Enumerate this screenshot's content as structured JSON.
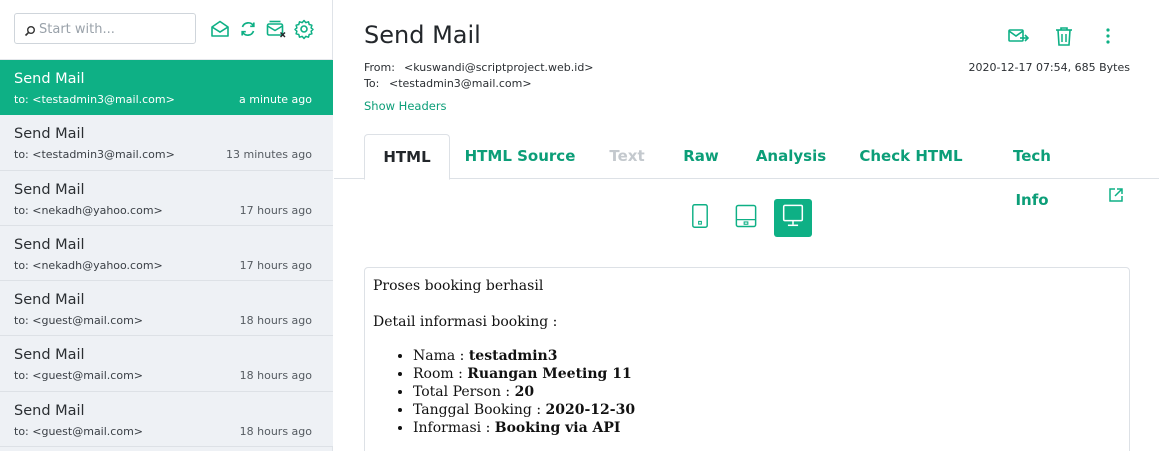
{
  "search": {
    "placeholder": "Start with..."
  },
  "toolbar_icons": [
    "mail-open-icon",
    "refresh-icon",
    "inbox-clear-icon",
    "settings-icon"
  ],
  "mails": [
    {
      "subject": "Send Mail",
      "to": "to: <testadmin3@mail.com>",
      "time": "a minute ago",
      "active": true
    },
    {
      "subject": "Send Mail",
      "to": "to: <testadmin3@mail.com>",
      "time": "13 minutes ago"
    },
    {
      "subject": "Send Mail",
      "to": "to: <nekadh@yahoo.com>",
      "time": "17 hours ago"
    },
    {
      "subject": "Send Mail",
      "to": "to: <nekadh@yahoo.com>",
      "time": "17 hours ago"
    },
    {
      "subject": "Send Mail",
      "to": "to: <guest@mail.com>",
      "time": "18 hours ago"
    },
    {
      "subject": "Send Mail",
      "to": "to: <guest@mail.com>",
      "time": "18 hours ago"
    },
    {
      "subject": "Send Mail",
      "to": "to: <guest@mail.com>",
      "time": "18 hours ago"
    }
  ],
  "message": {
    "title": "Send Mail",
    "from_label": "From:",
    "from": "<kuswandi@scriptproject.web.id>",
    "to_label": "To:",
    "to": "<testadmin3@mail.com>",
    "date_size": "2020-12-17 07:54, 685 Bytes",
    "show_headers": "Show Headers"
  },
  "tabs": [
    {
      "label": "HTML",
      "state": "active"
    },
    {
      "label": "HTML Source",
      "state": "normal"
    },
    {
      "label": "Text",
      "state": "disabled"
    },
    {
      "label": "Raw",
      "state": "normal"
    },
    {
      "label": "Analysis",
      "state": "normal"
    },
    {
      "label": "Check HTML",
      "state": "normal"
    },
    {
      "label": "Tech Info",
      "state": "normal"
    }
  ],
  "devices": [
    {
      "name": "mobile-view",
      "active": false
    },
    {
      "name": "tablet-view",
      "active": false
    },
    {
      "name": "desktop-view",
      "active": true
    }
  ],
  "body": {
    "line1": "Proses booking berhasil",
    "line2": "Detail informasi booking :",
    "items": [
      {
        "label": "Nama : ",
        "value": "testadmin3"
      },
      {
        "label": "Room : ",
        "value": "Ruangan Meeting 11"
      },
      {
        "label": "Total Person : ",
        "value": "20"
      },
      {
        "label": "Tanggal Booking : ",
        "value": "2020-12-30"
      },
      {
        "label": "Informasi : ",
        "value": "Booking via API"
      }
    ]
  },
  "colors": {
    "accent": "#0eb085",
    "link": "#0c9e78",
    "sidebar_bg": "#eef1f5"
  }
}
